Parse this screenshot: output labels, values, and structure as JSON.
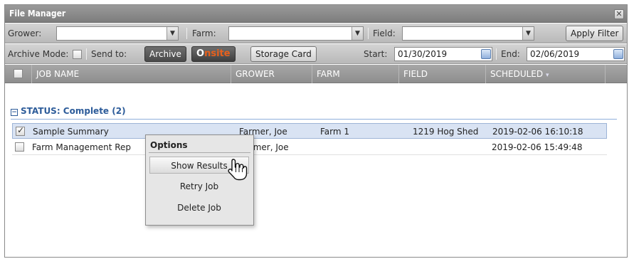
{
  "window": {
    "title": "File Manager",
    "close_glyph": "✕"
  },
  "filters": {
    "grower_label": "Grower:",
    "farm_label": "Farm:",
    "field_label": "Field:",
    "grower_value": "",
    "farm_value": "",
    "field_value": "",
    "apply_label": "Apply Filter"
  },
  "actions": {
    "archive_mode_label": "Archive Mode:",
    "send_to_label": "Send to:",
    "archive_label": "Archive",
    "onsite_o": "O",
    "onsite_n": "n",
    "onsite_site": "site",
    "storage_card_label": "Storage Card",
    "start_label": "Start:",
    "start_value": "01/30/2019",
    "end_label": "End:",
    "end_value": "02/06/2019"
  },
  "grid": {
    "columns": [
      "JOB NAME",
      "GROWER",
      "FARM",
      "FIELD",
      "SCHEDULED"
    ],
    "sort_glyph": "▾",
    "group_label": "STATUS: Complete (2)",
    "collapse_glyph": "−",
    "rows": [
      {
        "job": "Sample Summary",
        "grower": "Farmer, Joe",
        "farm": "Farm 1",
        "field": "1219 Hog Shed",
        "scheduled": "2019-02-06 16:10:18",
        "checked": true
      },
      {
        "job": "Farm Management Rep",
        "grower": "rmer, Joe",
        "farm": "",
        "field": "",
        "scheduled": "2019-02-06 15:49:48",
        "checked": false
      }
    ]
  },
  "context_menu": {
    "title": "Options",
    "items": [
      "Show Results",
      "Retry Job",
      "Delete Job"
    ]
  },
  "colors": {
    "group_blue": "#2d5c9a",
    "onsite_orange": "#e8601c",
    "selected_row": "#d9e3f3"
  }
}
